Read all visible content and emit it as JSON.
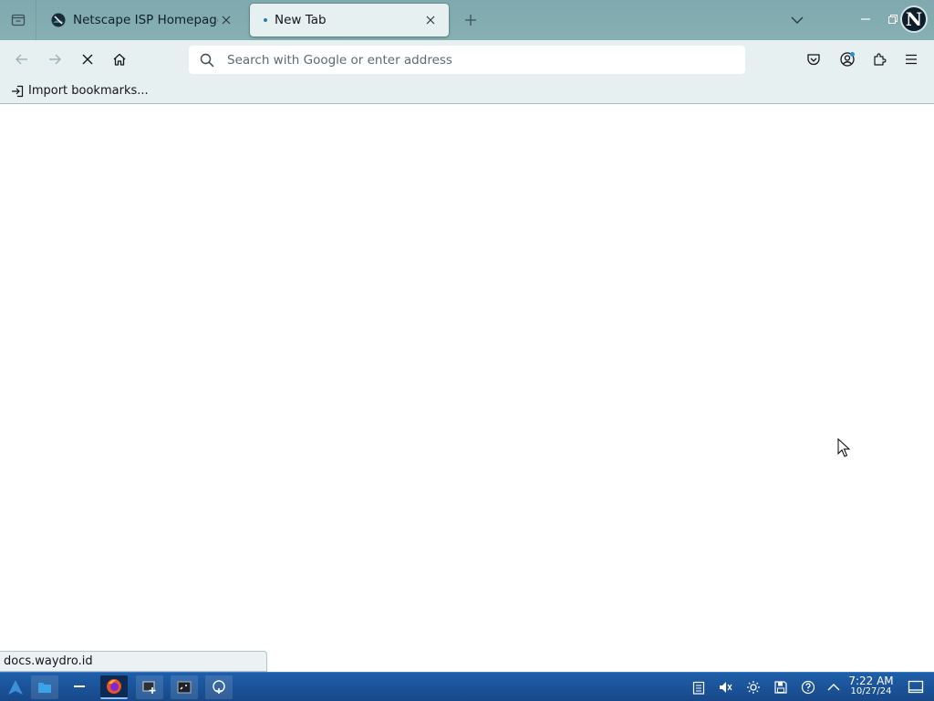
{
  "browser": {
    "tabs": [
      {
        "title": "Netscape ISP Homepage",
        "active": false,
        "favicon": "netscape-icon"
      },
      {
        "title": "New Tab",
        "active": true,
        "favicon": "loading-dot"
      }
    ],
    "urlbar": {
      "placeholder": "Search with Google or enter address",
      "value": ""
    },
    "bookmarks": {
      "import_label": "Import bookmarks..."
    },
    "status_text": "docs.waydro.id",
    "avatar_letter": "N"
  },
  "taskbar": {
    "time": "7:22 AM",
    "date": "10/27/24"
  },
  "colors": {
    "tabstrip": "#86b0b3",
    "toolbar": "#e6f0f1",
    "taskbar": "#1f5fa8",
    "accent": "#2a7ea4"
  }
}
